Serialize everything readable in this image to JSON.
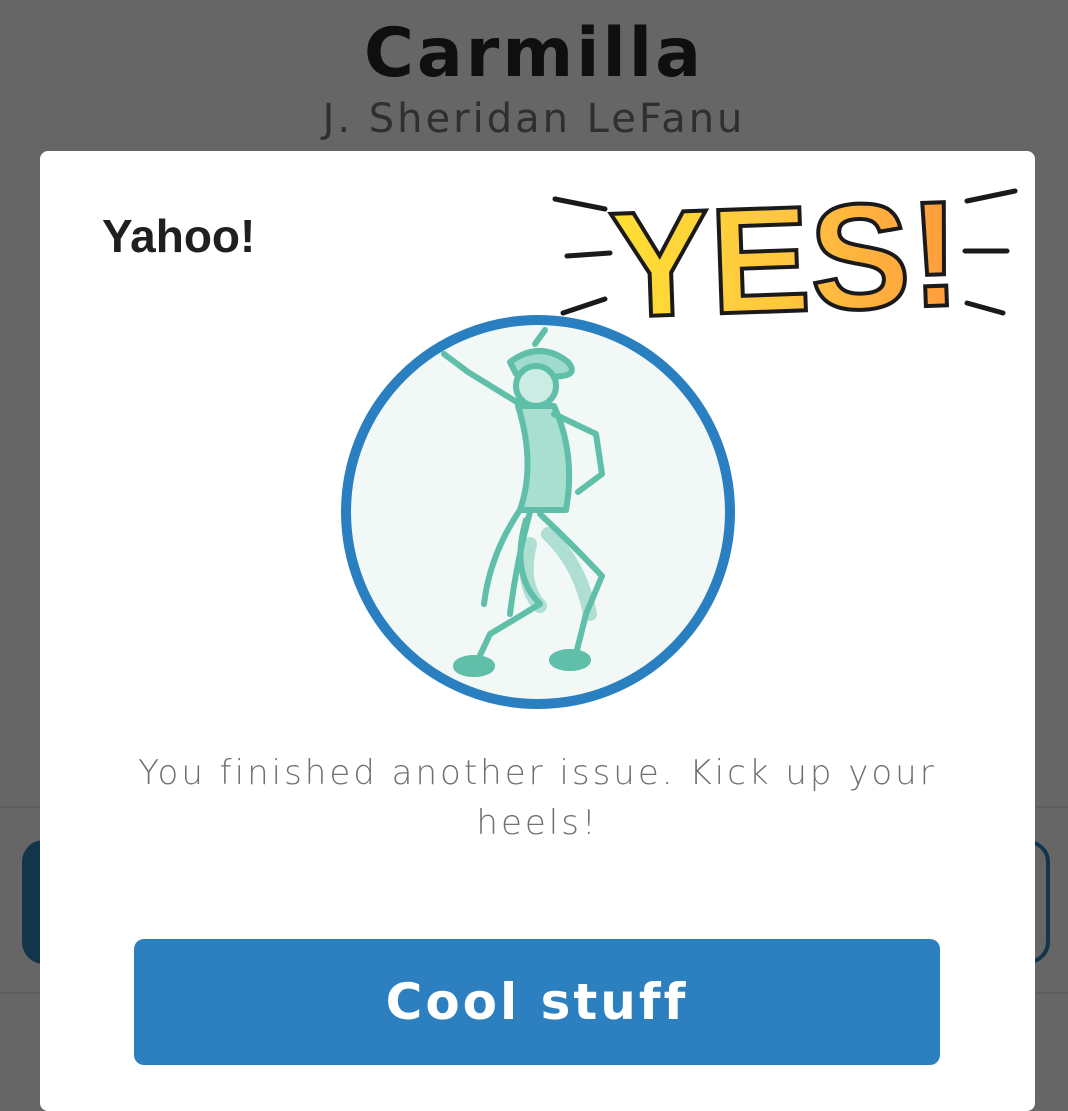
{
  "background": {
    "book_title": "Carmilla",
    "book_author": "J. Sheridan LeFanu"
  },
  "dialog": {
    "title": "Yahoo!",
    "celebration_text": "YES!",
    "message": "You finished another issue. Kick up your heels!",
    "button_label": "Cool stuff",
    "illustration_icon": "dancing-figure-illustration"
  },
  "colors": {
    "accent_blue": "#2c80c0",
    "illustration_teal": "#5fbfa8",
    "overlay": "#666666",
    "yes_gradient": [
      "#ffe033",
      "#ffc640",
      "#ff9a3c"
    ]
  }
}
